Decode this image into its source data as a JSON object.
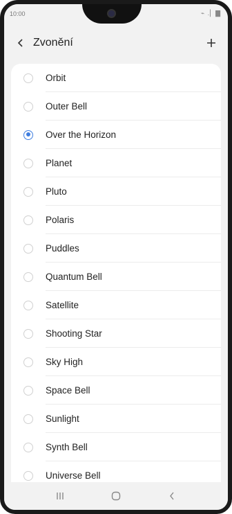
{
  "status": {
    "time": "10:00",
    "icons": "⌁ .▏▇"
  },
  "header": {
    "title": "Zvonění"
  },
  "ringtones": [
    {
      "label": "Orbit",
      "selected": false
    },
    {
      "label": "Outer Bell",
      "selected": false
    },
    {
      "label": "Over the Horizon",
      "selected": true
    },
    {
      "label": "Planet",
      "selected": false
    },
    {
      "label": "Pluto",
      "selected": false
    },
    {
      "label": "Polaris",
      "selected": false
    },
    {
      "label": "Puddles",
      "selected": false
    },
    {
      "label": "Quantum Bell",
      "selected": false
    },
    {
      "label": "Satellite",
      "selected": false
    },
    {
      "label": "Shooting Star",
      "selected": false
    },
    {
      "label": "Sky High",
      "selected": false
    },
    {
      "label": "Space Bell",
      "selected": false
    },
    {
      "label": "Sunlight",
      "selected": false
    },
    {
      "label": "Synth Bell",
      "selected": false
    },
    {
      "label": "Universe Bell",
      "selected": false
    }
  ],
  "colors": {
    "accent": "#3e7de0",
    "background": "#f2f2f2",
    "card": "#ffffff"
  },
  "icons": {
    "back": "chevron-left-icon",
    "add": "plus-icon",
    "recents": "recents-icon",
    "home": "home-icon",
    "nav_back": "nav-back-icon"
  }
}
